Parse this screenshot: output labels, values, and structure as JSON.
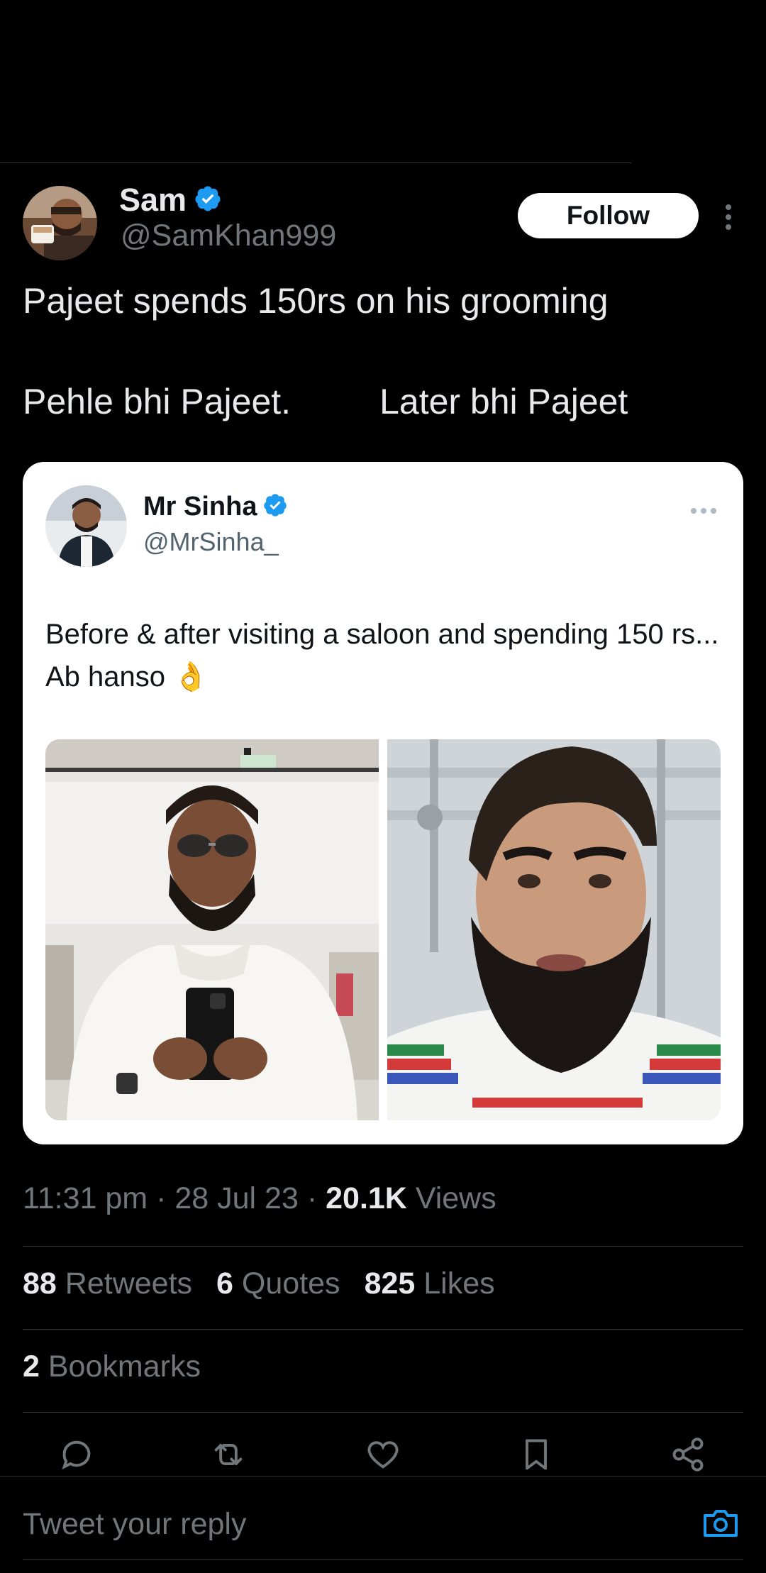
{
  "tweet": {
    "author": {
      "name": "Sam",
      "handle": "@SamKhan999",
      "verified": true
    },
    "follow_label": "Follow",
    "text_line1": "Pajeet spends 150rs on his grooming",
    "text_line2": "Pehle bhi Pajeet.         Later bhi Pajeet"
  },
  "quoted": {
    "author": {
      "name": "Mr Sinha",
      "handle": "@MrSinha_",
      "verified": true
    },
    "text": "Before & after visiting a saloon and spending 150 rs... Ab hanso",
    "emoji": "👌"
  },
  "meta": {
    "time": "11:31 pm",
    "date": "28 Jul 23",
    "views_count": "20.1K",
    "views_label": "Views",
    "sep": "·"
  },
  "stats": {
    "retweets_count": "88",
    "retweets_label": "Retweets",
    "quotes_count": "6",
    "quotes_label": "Quotes",
    "likes_count": "825",
    "likes_label": "Likes"
  },
  "bookmarks": {
    "count": "2",
    "label": "Bookmarks"
  },
  "actions": [
    "reply-icon",
    "retweet-icon",
    "like-icon",
    "bookmark-icon",
    "share-icon"
  ],
  "reply": {
    "placeholder": "Tweet your reply"
  },
  "colors": {
    "background": "#000000",
    "accent": "#1d9bf0",
    "muted": "#71767b",
    "text": "#e7e9ea"
  }
}
